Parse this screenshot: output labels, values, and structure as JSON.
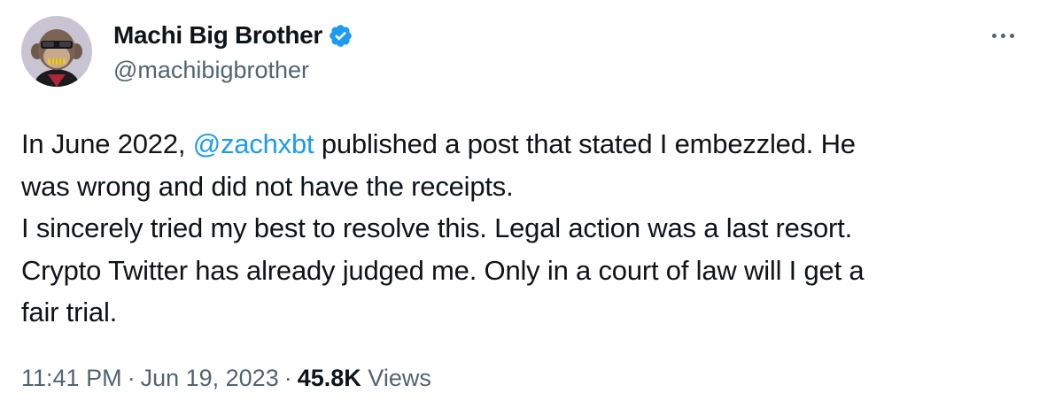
{
  "author": {
    "display_name": "Machi Big Brother",
    "handle": "@machibigbrother",
    "verified_icon": "verified-badge-icon",
    "avatar_icon": "ape-avatar-icon"
  },
  "colors": {
    "text": "#0f1419",
    "secondary": "#536471",
    "accent": "#1d9bf0"
  },
  "more_icon": "more-options-icon",
  "tweet": {
    "line1_before": "In June 2022, ",
    "line1_mention": "@zachxbt",
    "line1_after": " published a post that stated I embezzled. He",
    "line2": "was wrong and did not have the receipts.",
    "line3": "I sincerely tried my best to resolve this. Legal action was a last resort.",
    "line4": "Crypto Twitter has already judged me. Only in a court of law will I get a",
    "line5": "fair trial."
  },
  "meta": {
    "time": "11:41 PM",
    "separator": "·",
    "date": "Jun 19, 2023",
    "views_count": "45.8K",
    "views_label": "Views"
  }
}
